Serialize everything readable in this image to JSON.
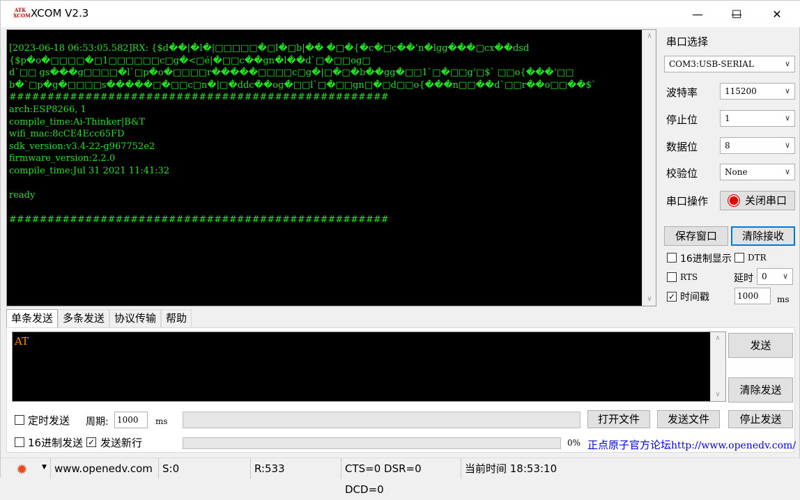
{
  "window": {
    "title": "XCOM V2.3",
    "logo_text_top": "ATK",
    "logo_text_bottom": "XCOM",
    "minimize_glyph": "—",
    "maximize_glyph": "☐",
    "close_glyph": "✕"
  },
  "receive": {
    "lines": [
      "[2023-06-18 06:53:05.582]RX: {$d��|�l�|□□□□□�□l�□b|�� �□�{�c�□c��’n�lgg���□cx��dsd",
      "{$p�o�□□□□�□1□□□□□□c□g�<□é|�□□c��gn�l��d`□�□□og□",
      "d`□□ gs���g□□□□�l`□p�o�□□□□r�����□□□□c□g�|□�□�b��gg�□□1`□�□□g’□$` □□o{���’□□",
      "b�`□p�g�□□□□s�����□�□□c□n�|□�ddc��og�□□l`□�□□gn□�□d□□o{���n□□��d`□□r��o□□��$`",
      "##################################################",
      "arch:ESP8266, 1",
      "compile_time:Ai-Thinker|B&T",
      "wifi_mac:8cCE4Ecc65FD",
      "sdk_version:v3.4-22-g967752e2",
      "firmware_version:2.2.0",
      "compile_time:Jul 31 2021 11:41:32",
      "",
      "ready",
      "",
      "##################################################"
    ]
  },
  "serial": {
    "port_label": "串口选择",
    "port_value": "COM3:USB-SERIAL",
    "baud_label": "波特率",
    "baud_value": "115200",
    "stopbits_label": "停止位",
    "stopbits_value": "1",
    "databits_label": "数据位",
    "databits_value": "8",
    "parity_label": "校验位",
    "parity_value": "None",
    "operation_label": "串口操作",
    "close_port_button": "关闭串口",
    "save_window_button": "保存窗口",
    "clear_receive_button": "清除接收",
    "hex_display_label": "16进制显示",
    "dtr_label": "DTR",
    "rts_label": "RTS",
    "delay_label": "延时",
    "delay_value": "0",
    "timestamp_label": "时间戳",
    "timestamp_checked": true,
    "timestamp_ms_value": "1000",
    "ms_unit": "ms"
  },
  "tabs": [
    {
      "label": "单条发送",
      "active": true
    },
    {
      "label": "多条发送",
      "active": false
    },
    {
      "label": "协议传输",
      "active": false
    },
    {
      "label": "帮助",
      "active": false
    }
  ],
  "send": {
    "text": "AT",
    "send_button": "发送",
    "clear_send_button": "清除发送",
    "timed_send_label": "定时发送",
    "period_label": "周期:",
    "period_value": "1000",
    "period_unit": "ms",
    "open_file_button": "打开文件",
    "send_file_button": "发送文件",
    "stop_send_button": "停止发送",
    "hex_send_label": "16进制发送",
    "send_newline_label": "发送新行",
    "send_newline_checked": true,
    "progress_text": "0%",
    "forum_link_cn": "正点原子官方论坛",
    "forum_link_url": "http://www.openedv.com/"
  },
  "statusbar": {
    "website": "www.openedv.com",
    "sent": "S:0",
    "received": "R:533",
    "signals": "CTS=0 DSR=0 DCD=0",
    "current_time": "当前时间 18:53:10"
  }
}
